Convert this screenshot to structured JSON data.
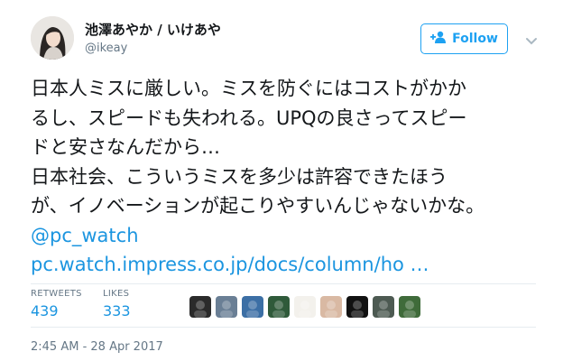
{
  "user": {
    "display_name": "池澤あやか / いけあや",
    "handle": "@ikeay"
  },
  "follow_button": {
    "label": "Follow"
  },
  "tweet": {
    "lines": [
      "日本人ミスに厳しい。ミスを防ぐにはコストがかか",
      "るし、スピードも失われる。UPQの良さってスピー",
      "ドと安さなんだから…",
      "日本社会、こういうミスを多少は許容できたほう",
      "が、イノベーションが起こりやすいんじゃないかな。"
    ],
    "mention": "@pc_watch",
    "link": "pc.watch.impress.co.jp/docs/column/ho …"
  },
  "stats": {
    "retweets_label": "RETWEETS",
    "retweets_value": "439",
    "likes_label": "LIKES",
    "likes_value": "333"
  },
  "liker_avatars": [
    {
      "name": "liker-avatar-1",
      "bg": "#2b2b2b"
    },
    {
      "name": "liker-avatar-2",
      "bg": "#6a7f95"
    },
    {
      "name": "liker-avatar-3",
      "bg": "#3c6fa5"
    },
    {
      "name": "liker-avatar-4",
      "bg": "#2f5a3a"
    },
    {
      "name": "liker-avatar-5",
      "bg": "#f3f1ec"
    },
    {
      "name": "liker-avatar-6",
      "bg": "#d9b9a3"
    },
    {
      "name": "liker-avatar-7",
      "bg": "#111111"
    },
    {
      "name": "liker-avatar-8",
      "bg": "#4d5a52"
    },
    {
      "name": "liker-avatar-9",
      "bg": "#3f6b3a"
    }
  ],
  "timestamp": "2:45 AM - 28 Apr 2017",
  "colors": {
    "accent": "#1da1f2",
    "link": "#1b95e0",
    "muted": "#657786",
    "text": "#14171a"
  }
}
